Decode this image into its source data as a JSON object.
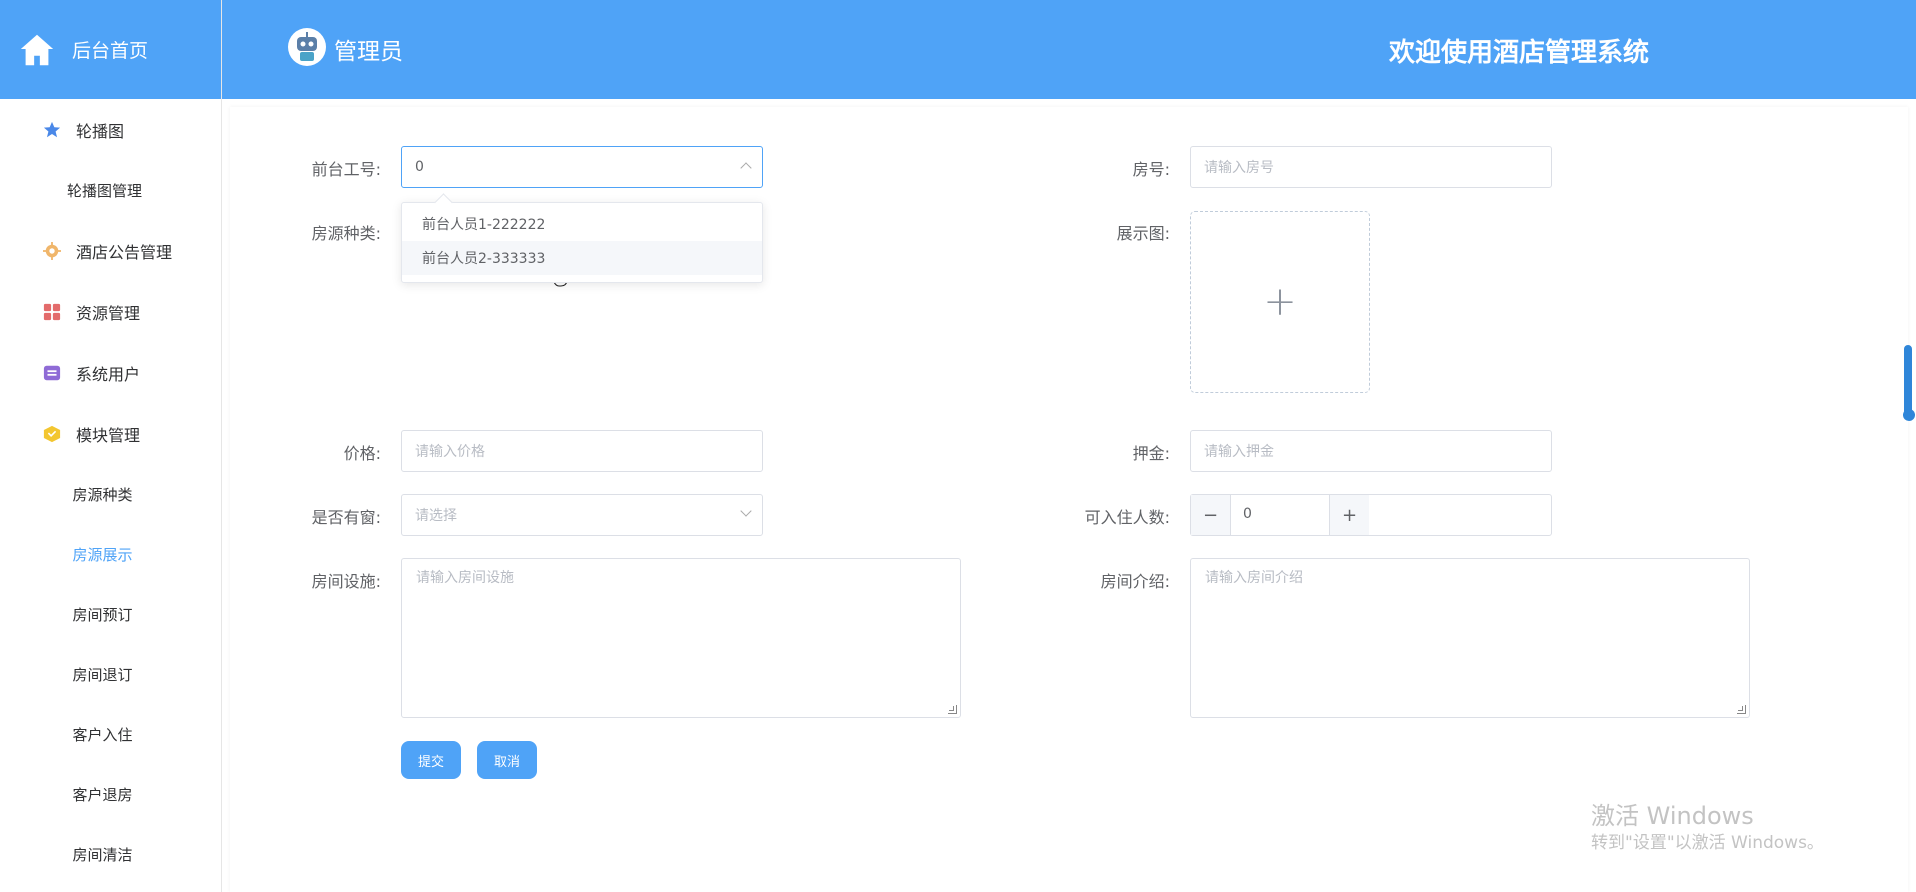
{
  "sidebar": {
    "home_label": "后台首页",
    "items": [
      {
        "label": "轮播图",
        "icon": "star-icon",
        "icon_color": "#4a88e8"
      },
      {
        "label": "轮播图管理"
      },
      {
        "label": "酒店公告管理",
        "icon": "gear-icon",
        "icon_color": "#f0b66b"
      },
      {
        "label": "资源管理",
        "icon": "grid-icon",
        "icon_color": "#e36b6b"
      },
      {
        "label": "系统用户",
        "icon": "box-icon",
        "icon_color": "#8f6bd6"
      },
      {
        "label": "模块管理",
        "icon": "cube-icon",
        "icon_color": "#f3c630"
      },
      {
        "label": "房源种类"
      },
      {
        "label": "房源展示",
        "active": true
      },
      {
        "label": "房间预订"
      },
      {
        "label": "房间退订"
      },
      {
        "label": "客户入住"
      },
      {
        "label": "客户退房"
      },
      {
        "label": "房间清洁"
      }
    ]
  },
  "header": {
    "user": "管理员",
    "welcome": "欢迎使用酒店管理系统",
    "color": "#4fa3f7"
  },
  "form": {
    "staff_no": {
      "label": "前台工号:",
      "value": "0"
    },
    "room_no": {
      "label": "房号:",
      "placeholder": "请输入房号"
    },
    "room_type": {
      "label": "房源种类:"
    },
    "image": {
      "label": "展示图:"
    },
    "price": {
      "label": "价格:",
      "placeholder": "请输入价格"
    },
    "deposit": {
      "label": "押金:",
      "placeholder": "请输入押金"
    },
    "window": {
      "label": "是否有窗:",
      "placeholder": "请选择"
    },
    "capacity": {
      "label": "可入住人数:",
      "value": "0"
    },
    "facilities": {
      "label": "房间设施:",
      "placeholder": "请输入房间设施"
    },
    "intro": {
      "label": "房间介绍:",
      "placeholder": "请输入房间介绍"
    },
    "submit": "提交",
    "cancel": "取消"
  },
  "dropdown": {
    "options": [
      "前台人员1-222222",
      "前台人员2-333333"
    ]
  },
  "watermark": {
    "line1": "激活 Windows",
    "line2": "转到\"设置\"以激活 Windows。"
  }
}
